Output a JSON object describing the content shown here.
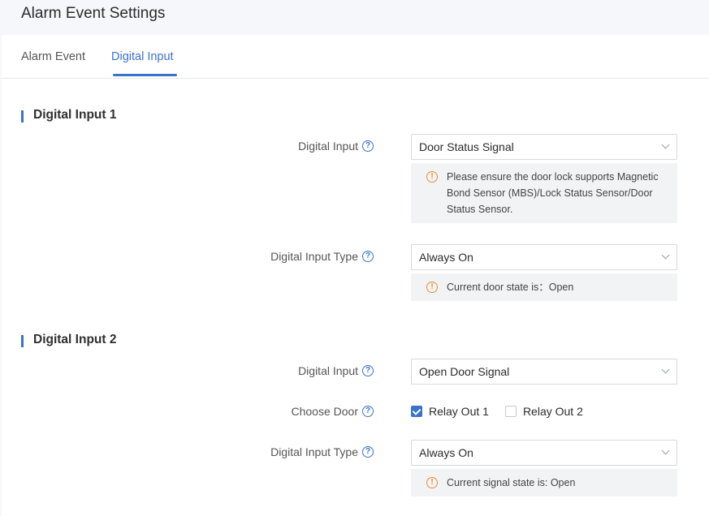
{
  "header": {
    "title": "Alarm Event Settings"
  },
  "tabs": [
    {
      "label": "Alarm Event"
    },
    {
      "label": "Digital Input"
    }
  ],
  "section1": {
    "title": "Digital Input 1",
    "digital_input_label": "Digital Input",
    "digital_input_value": "Door Status Signal",
    "notice1": "Please ensure the door lock supports Magnetic Bond Sensor (MBS)/Lock Status Sensor/Door Status Sensor.",
    "type_label": "Digital Input Type",
    "type_value": "Always On",
    "notice2": "Current door state is：Open"
  },
  "section2": {
    "title": "Digital Input 2",
    "digital_input_label": "Digital Input",
    "digital_input_value": "Open Door Signal",
    "choose_door_label": "Choose Door",
    "doors": [
      {
        "label": "Relay Out 1",
        "checked": true
      },
      {
        "label": "Relay Out 2",
        "checked": false
      }
    ],
    "type_label": "Digital Input Type",
    "type_value": "Always On",
    "notice": "Current signal state is: Open"
  },
  "icons": {
    "help": "question-circle-icon",
    "warning": "exclamation-circle-icon",
    "dropdown": "chevron-down-icon"
  },
  "colors": {
    "accent": "#3a73cc",
    "warning": "#f08c2e"
  }
}
